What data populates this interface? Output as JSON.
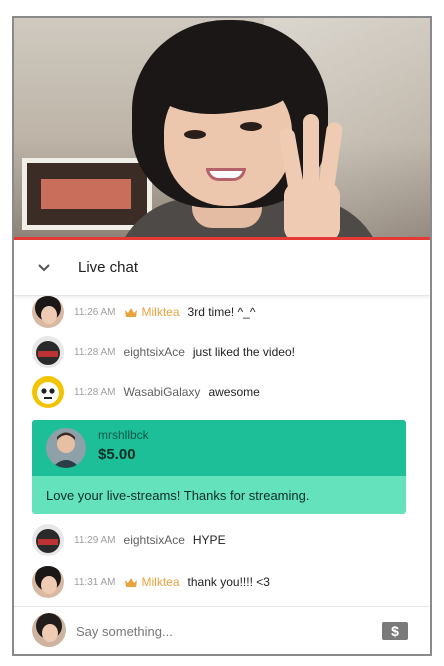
{
  "chat": {
    "title": "Live chat",
    "accent_color": "#e53935",
    "member_color": "#e8a33d",
    "messages": [
      {
        "time": "11:26 AM",
        "author": "Milktea",
        "member": true,
        "text": "3rd time! ^_^",
        "avatar": "girl-avatar"
      },
      {
        "time": "11:28 AM",
        "author": "eightsixAce",
        "member": false,
        "text": "just liked the video!",
        "avatar": "helmet-avatar"
      },
      {
        "time": "11:28 AM",
        "author": "WasabiGalaxy",
        "member": false,
        "text": "awesome",
        "avatar": "robot-avatar"
      },
      {
        "time": "11:29 AM",
        "author": "eightsixAce",
        "member": false,
        "text": "HYPE",
        "avatar": "helmet-avatar"
      },
      {
        "time": "11:31 AM",
        "author": "Milktea",
        "member": true,
        "text": "thank you!!!! <3",
        "avatar": "girl-avatar"
      }
    ],
    "superchat": {
      "author": "mrshllbck",
      "amount": "$5.00",
      "message": "Love your live-streams! Thanks for streaming.",
      "header_color": "#1dbf98",
      "body_color": "#63e2bb"
    }
  },
  "input": {
    "placeholder": "Say something...",
    "icon": "dollar-icon"
  }
}
